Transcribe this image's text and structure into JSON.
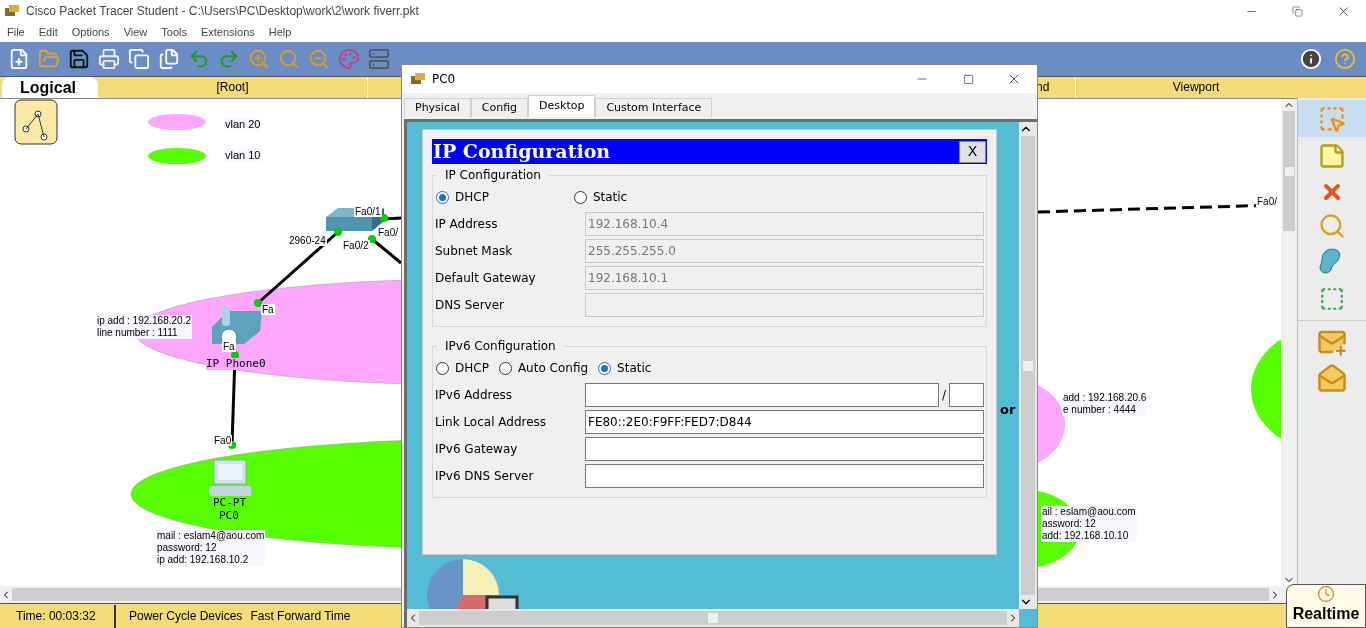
{
  "window": {
    "title": "Cisco Packet Tracer Student - C:\\Users\\PC\\Desktop\\work\\2\\work fiverr.pkt"
  },
  "menu": [
    "File",
    "Edit",
    "Options",
    "View",
    "Tools",
    "Extensions",
    "Help"
  ],
  "workspace_bar": {
    "logical_tab": "Logical",
    "root": "[Root]",
    "cut_label": "nd",
    "viewport": "Viewport"
  },
  "legend": [
    {
      "label": "vlan 20",
      "color": "#ffa6ff"
    },
    {
      "label": "vlan 10",
      "color": "#55ff00"
    }
  ],
  "canvas": {
    "port_labels": [
      "Fa0/1",
      "Fa0/",
      "Fa0/2",
      "Fa",
      "Fa",
      "Fa0",
      "Fa0/"
    ],
    "devices": [
      {
        "kind": "switch",
        "model": "2960-24"
      },
      {
        "kind": "phone",
        "name": "IP Phone0"
      },
      {
        "kind": "pc",
        "model": "PC-PT",
        "name": "PC0"
      }
    ],
    "notes": [
      [
        "ip add : 192.168.20.2",
        "line number : 1111"
      ],
      [
        "mail : eslam4@aou.com",
        "password: 12",
        "ip add: 192.168.10.2"
      ],
      [
        "add : 192.168.20.6",
        "e number : 4444"
      ],
      [
        "ail : eslam@aou.com",
        "assword: 12",
        "add: 192.168.10.10"
      ]
    ]
  },
  "status_bar": {
    "time": "Time: 00:03:32",
    "power_cycle": "Power Cycle Devices",
    "fast_forward": "Fast Forward Time",
    "mode": "Realtime"
  },
  "dialog": {
    "title": "PC0",
    "tabs": [
      {
        "label": "Physical",
        "selected": false
      },
      {
        "label": "Config",
        "selected": false
      },
      {
        "label": "Desktop",
        "selected": true
      },
      {
        "label": "Custom Interface",
        "selected": false
      }
    ],
    "behind_text": "or",
    "panel_title": "IP Configuration",
    "close": "X",
    "ipv4": {
      "legend": "IP Configuration",
      "modes": [
        {
          "label": "DHCP",
          "selected": true
        },
        {
          "label": "Static",
          "selected": false
        }
      ],
      "fields": [
        {
          "label": "IP Address",
          "value": "192.168.10.4",
          "disabled": true
        },
        {
          "label": "Subnet Mask",
          "value": "255.255.255.0",
          "disabled": true
        },
        {
          "label": "Default Gateway",
          "value": "192.168.10.1",
          "disabled": true
        },
        {
          "label": "DNS Server",
          "disabled": true
        }
      ]
    },
    "ipv6": {
      "legend": "IPv6 Configuration",
      "modes": [
        {
          "label": "DHCP",
          "selected": false
        },
        {
          "label": "Auto Config",
          "selected": false
        },
        {
          "label": "Static",
          "selected": true
        }
      ],
      "prefix_separator": "/",
      "fields": [
        {
          "label": "IPv6 Address",
          "disabled": false,
          "has_prefix": true
        },
        {
          "label": "Link Local Address",
          "value": "FE80::2E0:F9FF:FED7:D844",
          "disabled": false
        },
        {
          "label": "IPv6 Gateway",
          "disabled": false
        },
        {
          "label": "IPv6 DNS Server",
          "disabled": false
        }
      ]
    }
  }
}
